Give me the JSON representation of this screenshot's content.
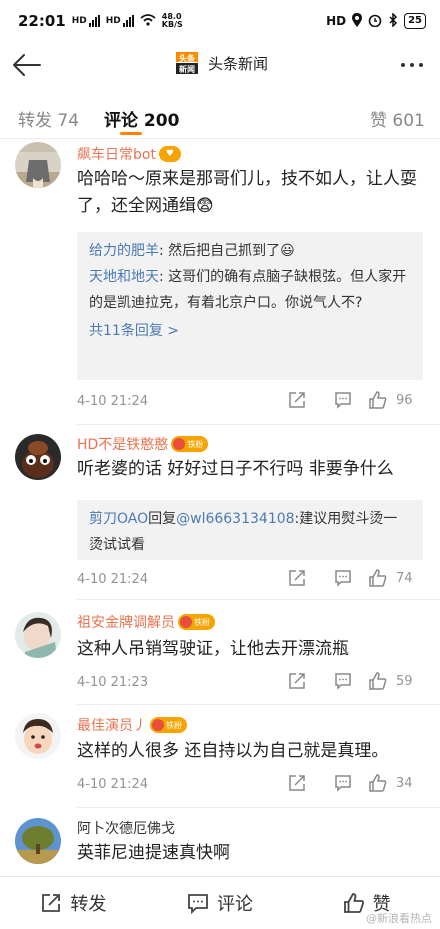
{
  "status_bar": {
    "time": "22:01",
    "signal_1": "HD",
    "network_speed": "48.0 KB/S",
    "right_text": "HD",
    "battery": "25"
  },
  "nav": {
    "title": "头条新闻",
    "logo_text": "头条新闻",
    "icons": [
      "back-arrow-icon",
      "more-dots-icon"
    ]
  },
  "tabs": {
    "repost": "转发 74",
    "comments": "评论 200",
    "likes": "赞 601",
    "accent_color": "#ff8200"
  },
  "comments": [
    {
      "name": "飙车日常bot",
      "text": "哈哈哈～原来是那哥们儿，技不如人，让人耍了，还全网通缉😨",
      "replies": [
        {
          "name": "给力的肥羊",
          "text": ": 然后把自己抓到了😃"
        },
        {
          "name": "天地和地天",
          "text": ": 这哥们的确有点脑子缺根弦。但人家开的是凯迪拉克，有着北京户口。你说气人不?"
        }
      ],
      "more": "共11条回复 >",
      "time": "4-10 21:24",
      "likes": "96"
    },
    {
      "name": "HD不是铁憨憨",
      "badge": "铁粉",
      "text": "听老婆的话 好好过日子不行吗 非要争什么",
      "reply_prefix": "剪刀OAO",
      "reply_mid": "回复",
      "reply_mention": "@wl6663134108",
      "reply_text": ":建议用熨斗烫一烫试试看",
      "time": "4-10 21:24",
      "likes": "74"
    },
    {
      "name": "祖安金牌调解员",
      "badge": "铁粉",
      "text": "这种人吊销驾驶证，让他去开漂流瓶",
      "time": "4-10 21:23",
      "likes": "59"
    },
    {
      "name": "最佳演员丿",
      "badge": "铁粉",
      "text": "这样的人很多 还自持以为自己就是真理。",
      "time": "4-10 21:24",
      "likes": "34"
    },
    {
      "name": "阿卜次德厄佛戈",
      "text": "英菲尼迪提速真快啊"
    }
  ],
  "bottom_bar": {
    "repost": "转发",
    "comment": "评论",
    "like": "赞"
  },
  "watermark": "@新浪看热点"
}
